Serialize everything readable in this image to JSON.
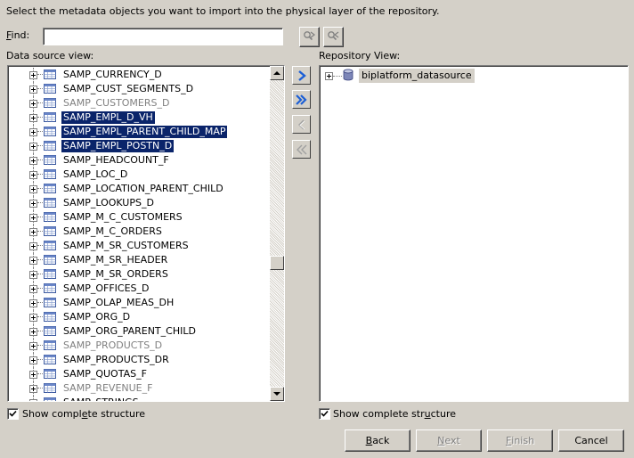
{
  "instruction": "Select the metadata objects you want to import into the physical layer of the repository.",
  "find": {
    "label_prefix": "",
    "label_key": "F",
    "label_rest": "ind:",
    "value": ""
  },
  "data_source_view": {
    "label": "Data source view:",
    "items": [
      {
        "name": "SAMP_CURRENCY_D",
        "selected": false,
        "dimmed": false
      },
      {
        "name": "SAMP_CUST_SEGMENTS_D",
        "selected": false,
        "dimmed": false
      },
      {
        "name": "SAMP_CUSTOMERS_D",
        "selected": false,
        "dimmed": true
      },
      {
        "name": "SAMP_EMPL_D_VH",
        "selected": true,
        "dimmed": false
      },
      {
        "name": "SAMP_EMPL_PARENT_CHILD_MAP",
        "selected": true,
        "dimmed": false
      },
      {
        "name": "SAMP_EMPL_POSTN_D",
        "selected": true,
        "dimmed": false
      },
      {
        "name": "SAMP_HEADCOUNT_F",
        "selected": false,
        "dimmed": false
      },
      {
        "name": "SAMP_LOC_D",
        "selected": false,
        "dimmed": false
      },
      {
        "name": "SAMP_LOCATION_PARENT_CHILD",
        "selected": false,
        "dimmed": false
      },
      {
        "name": "SAMP_LOOKUPS_D",
        "selected": false,
        "dimmed": false
      },
      {
        "name": "SAMP_M_C_CUSTOMERS",
        "selected": false,
        "dimmed": false
      },
      {
        "name": "SAMP_M_C_ORDERS",
        "selected": false,
        "dimmed": false
      },
      {
        "name": "SAMP_M_SR_CUSTOMERS",
        "selected": false,
        "dimmed": false
      },
      {
        "name": "SAMP_M_SR_HEADER",
        "selected": false,
        "dimmed": false
      },
      {
        "name": "SAMP_M_SR_ORDERS",
        "selected": false,
        "dimmed": false
      },
      {
        "name": "SAMP_OFFICES_D",
        "selected": false,
        "dimmed": false
      },
      {
        "name": "SAMP_OLAP_MEAS_DH",
        "selected": false,
        "dimmed": false
      },
      {
        "name": "SAMP_ORG_D",
        "selected": false,
        "dimmed": false
      },
      {
        "name": "SAMP_ORG_PARENT_CHILD",
        "selected": false,
        "dimmed": false
      },
      {
        "name": "SAMP_PRODUCTS_D",
        "selected": false,
        "dimmed": true
      },
      {
        "name": "SAMP_PRODUCTS_DR",
        "selected": false,
        "dimmed": false
      },
      {
        "name": "SAMP_QUOTAS_F",
        "selected": false,
        "dimmed": false
      },
      {
        "name": "SAMP_REVENUE_F",
        "selected": false,
        "dimmed": true
      },
      {
        "name": "SAMP_STRINGS",
        "selected": false,
        "dimmed": false
      }
    ],
    "scroll_position": 0.6
  },
  "repository_view": {
    "label": "Repository View:",
    "root": "biplatform_datasource"
  },
  "show_complete_structure_left": {
    "label_a": "Show compl",
    "label_key": "e",
    "label_b": "te structure",
    "checked": true
  },
  "show_complete_structure_right": {
    "label_a": "Show complete str",
    "label_key": "u",
    "label_b": "cture",
    "checked": true
  },
  "buttons": {
    "back": {
      "key": "B",
      "rest": "ack",
      "enabled": true
    },
    "next": {
      "key": "N",
      "rest": "ext",
      "enabled": false
    },
    "finish": {
      "key": "F",
      "rest": "inish",
      "enabled": false
    },
    "cancel": {
      "label": "Cancel",
      "enabled": true
    }
  },
  "colors": {
    "selection": "#0a246a",
    "arrow_blue": "#1c5fd6",
    "face": "#d4d0c8"
  },
  "icons": {
    "find_next": "find-next-icon",
    "find_prev": "find-previous-icon",
    "table": "table-icon",
    "database": "database-icon",
    "move_right": "move-right-icon",
    "move_all_right": "move-all-right-icon",
    "move_left": "move-left-icon",
    "move_all_left": "move-all-left-icon"
  }
}
